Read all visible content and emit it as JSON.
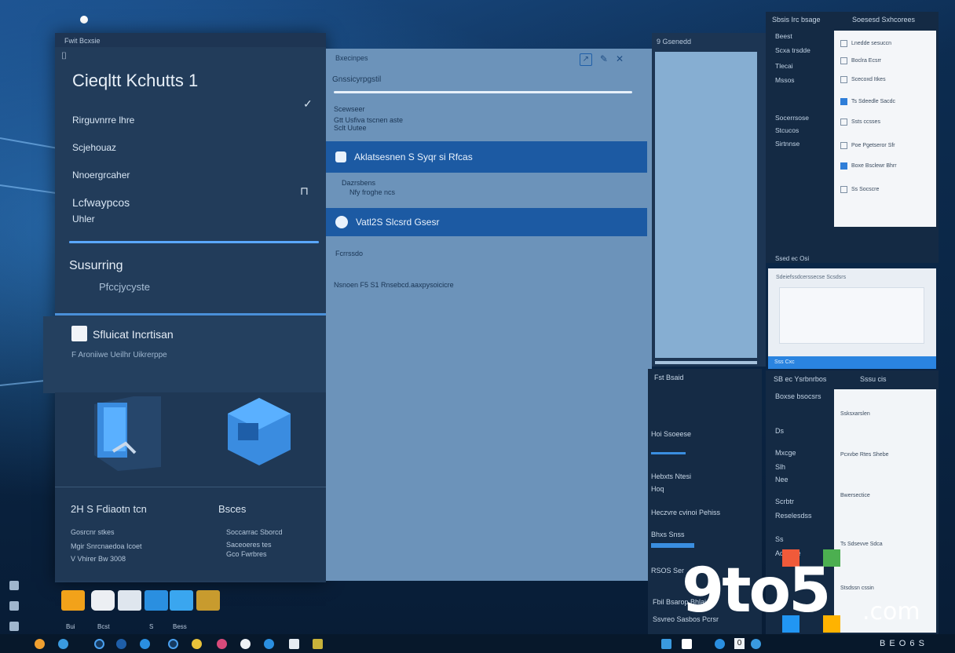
{
  "left_window": {
    "titlebar": "Fwit Bcxsie",
    "title": "Cieqltt Kchutts 1",
    "nav": [
      "Rirguvnrre lhre",
      "Scjehouaz",
      "Nnoergrcaher",
      "Lcfwaypcos",
      "Uhler"
    ],
    "section_title": "Susurring",
    "section_sub": "Pfccjycyste",
    "progress_fraction": 1.0
  },
  "lower_card": {
    "title": "Sfluicat Incrtisan",
    "subtitle": "F Aroniiwe Ueilhr Uikrerppe"
  },
  "tiles": {
    "row1_left": "2H S Fdiaotn tcn",
    "row1_right": "Bsces",
    "row2_left_lines": [
      "Gosrcnr stkes",
      "Mgir Snrcnaedoa Icoet",
      "V Vhirer Bw 3008"
    ],
    "row2_right_lines": [
      "Soccarrac Sborcd",
      "Saceoeres tes",
      "Gco Fwrbres"
    ]
  },
  "center_panel": {
    "topbar": "Bxecinpes",
    "search_label": "Gnssicyrpgstil",
    "label1": "Scewseer",
    "label2": "Gtt Usfiva tscnen aste",
    "label3": "Sclt Uutee",
    "row1": "Aklatsesnen S Syqr si Rfcas",
    "label4": "Dazrsbens",
    "label5": "Nfy froghe ncs",
    "row2": "Vatl2S Slcsrd Gsesr",
    "label6": "Fcrrssdo",
    "label7": "Nsnoen F5 S1 Rnsebcd.aaxpysoicicre"
  },
  "strip": {
    "header": "9 Gsenedd",
    "lower_lines": [
      "Fst Bsaid",
      "Hoi Ssoeese",
      "Hebxts Ntesi",
      "Hoq",
      "Heczvre cvinoi Pehiss",
      "Bhxs Snss",
      "RSOS Ser",
      "Fbil Bsarop Bhlai",
      "Ssvreo Sasbos Pcrsr"
    ]
  },
  "right_top": {
    "header": "Sbsis Irc bsage",
    "header2": "Soesesd Sxhcorees",
    "side": [
      "Beest",
      "Scxa trsdde",
      "Tlecai",
      "Mssos",
      "Socerrsose",
      "Stcucos",
      "Sirtnnse"
    ],
    "sheet_lines": [
      "Lnedde sesuccn",
      "Boclra Ecsrr",
      "Scecoxd Itkes",
      "Ts Sdeedle Sacdc",
      "Ssts ccsses",
      "Poe Pgetseror Sfr",
      "Boxe Bsclewr Bhrr",
      "Ss Socscre"
    ],
    "footer": "Ssed ec Osi"
  },
  "right_mid": {
    "title": "Sdeiefssdcerssecse Scsdsrs",
    "bar": "Sss Cxc"
  },
  "right_bot": {
    "header": "SB ec Ysrbnrbos",
    "header2": "Sssu cis",
    "side": [
      "Boxse bsocsrs",
      "Ds",
      "Mxcge",
      "Slh",
      "Nee",
      "Scrbtr",
      "Reselesdss",
      "Ss",
      "Adicbde"
    ],
    "sheet_lines": [
      "Ssksxarslen",
      "Pcxvbe Rtes Shebe",
      "Bwersectice",
      "Ts Sdsevve Sdca",
      "Stsdssn cssin"
    ]
  },
  "dock": [
    "Bui",
    "Bcst",
    "S",
    "Bess"
  ],
  "taskbar_right": "B E O 6 S",
  "watermark": {
    "main": "9to5",
    "suffix": ".com"
  },
  "colors": {
    "accent": "#1c5aa3",
    "accent_light": "#5aa8ff",
    "panel": "#223c5a",
    "center": "#6c93ba"
  }
}
